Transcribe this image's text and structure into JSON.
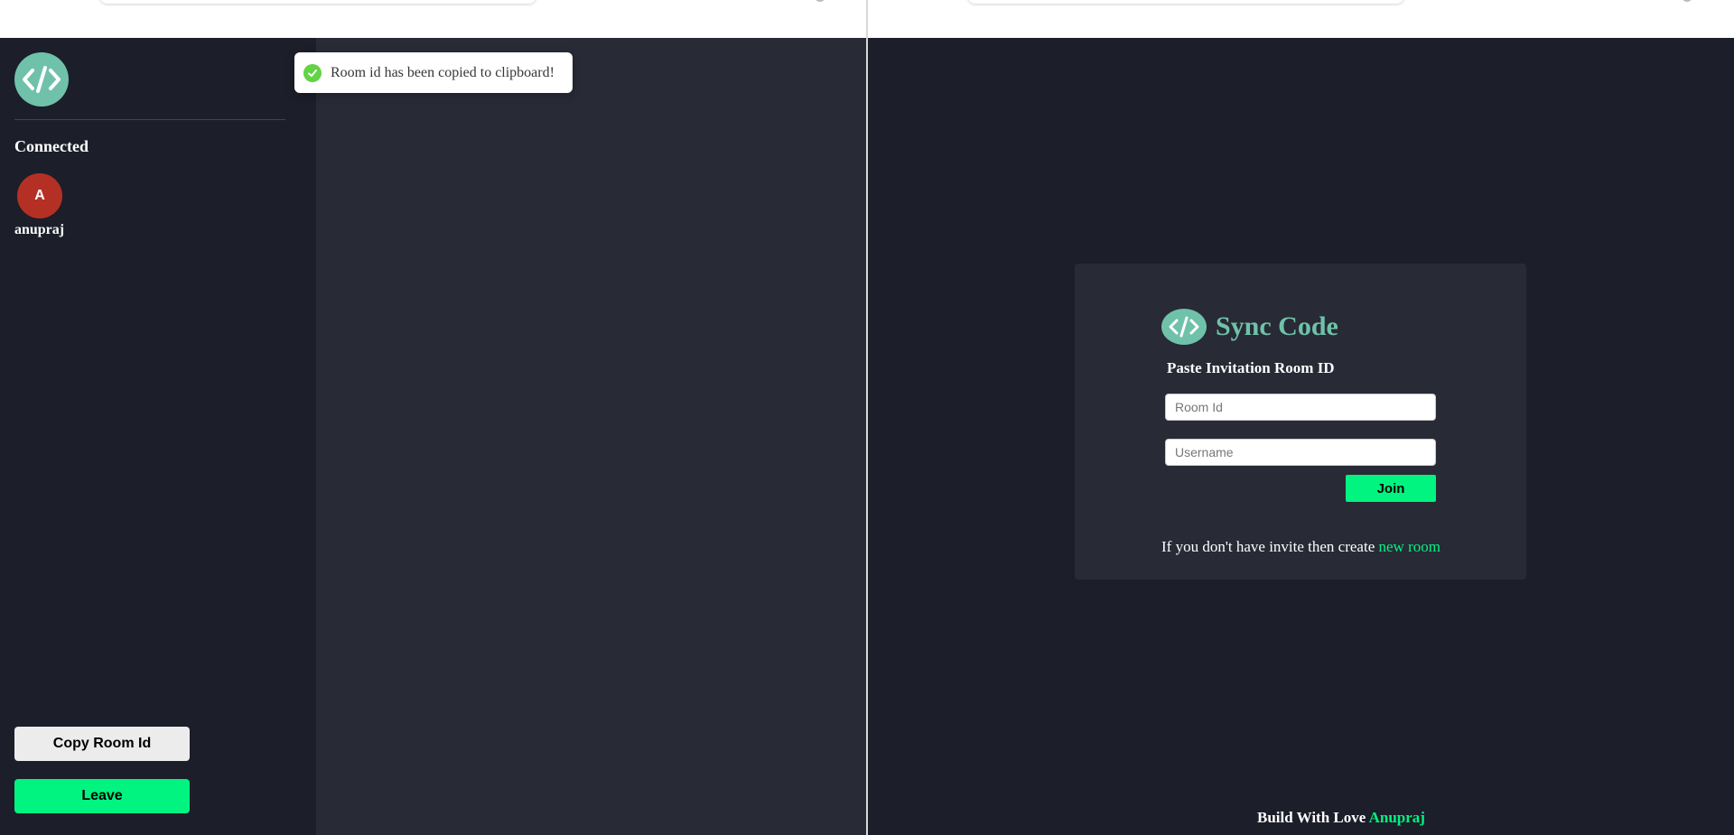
{
  "left": {
    "sidebar": {
      "logo": "code-brackets-icon",
      "connected_title": "Connected",
      "clients": [
        {
          "initial": "A",
          "username": "anupraj",
          "avatar_color": "#b53024"
        }
      ],
      "copy_button": "Copy Room Id",
      "leave_button": "Leave"
    },
    "toast": {
      "message": "Room id has been copied to clipboard!",
      "icon": "success-check-icon"
    }
  },
  "right": {
    "brand": {
      "logo": "code-brackets-icon",
      "title": "Sync Code"
    },
    "form": {
      "label": "Paste Invitation Room ID",
      "room_id_placeholder": "Room Id",
      "room_id_value": "",
      "username_placeholder": "Username",
      "username_value": "",
      "join_button": "Join"
    },
    "invite": {
      "text": "If you don't have invite then create ",
      "link": "new room"
    },
    "footer": {
      "text": "Build With Love ",
      "author": "Anupraj"
    }
  },
  "colors": {
    "background": "#1c1e29",
    "panel": "#282a36",
    "accent": "#00f47f",
    "brand_teal": "#6fc2a9",
    "success": "#61d345"
  }
}
